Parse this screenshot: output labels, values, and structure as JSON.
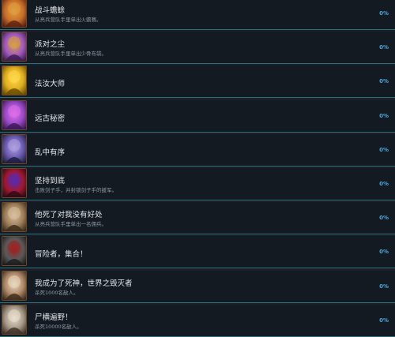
{
  "achievements": [
    {
      "title": "战斗蟾蜍",
      "desc": "从亮兵营队手里单出火蟾赛。",
      "percent": "0%",
      "icon": "warrior-icon",
      "colors": [
        "#5a1e10",
        "#c8702a",
        "#e0a040"
      ]
    },
    {
      "title": "派对之尘",
      "desc": "从亮兵营队手里单出少骨布袋。",
      "percent": "0%",
      "icon": "party-mage-icon",
      "colors": [
        "#3a1a4a",
        "#a05ac0",
        "#d9a040"
      ]
    },
    {
      "title": "法汝大师",
      "desc": "",
      "percent": "0%",
      "icon": "golden-mask-icon",
      "colors": [
        "#6a4a00",
        "#e0b020",
        "#ffd84a"
      ]
    },
    {
      "title": "远古秘密",
      "desc": "",
      "percent": "0%",
      "icon": "ancient-secret-icon",
      "colors": [
        "#3a1650",
        "#9a4ac8",
        "#e070e8"
      ]
    },
    {
      "title": "乱中有序",
      "desc": "",
      "percent": "0%",
      "icon": "sorcerer-icon",
      "colors": [
        "#1a1a3a",
        "#6a5ab0",
        "#b0a0e0"
      ]
    },
    {
      "title": "坚持到底",
      "desc": "击败剑子手，并封锁剑子手的援军。",
      "percent": "0%",
      "icon": "red-knight-icon",
      "colors": [
        "#2a0a14",
        "#a01830",
        "#5a2ab0"
      ]
    },
    {
      "title": "他死了对我没有好处",
      "desc": "从亮兵营队手里单出一名佣兵。",
      "percent": "0%",
      "icon": "mercenary-icon",
      "colors": [
        "#3a2a1a",
        "#a0805a",
        "#d8c0a0"
      ]
    },
    {
      "title": "冒险者，集合！",
      "desc": "",
      "percent": "0%",
      "icon": "adventurers-icon",
      "colors": [
        "#1a1a1a",
        "#5a5a5a",
        "#a02020"
      ]
    },
    {
      "title": "我成为了死神，世界之毁灭者",
      "desc": "杀死1000名敌人。",
      "percent": "0%",
      "icon": "skull-warrior-icon",
      "colors": [
        "#3a2a1a",
        "#b08a6a",
        "#e8d8c0"
      ]
    },
    {
      "title": "尸横遍野！",
      "desc": "杀死10000名敌人。",
      "percent": "0%",
      "icon": "skull-pile-icon",
      "colors": [
        "#3a3026",
        "#a89a88",
        "#e8e0d0"
      ]
    }
  ]
}
